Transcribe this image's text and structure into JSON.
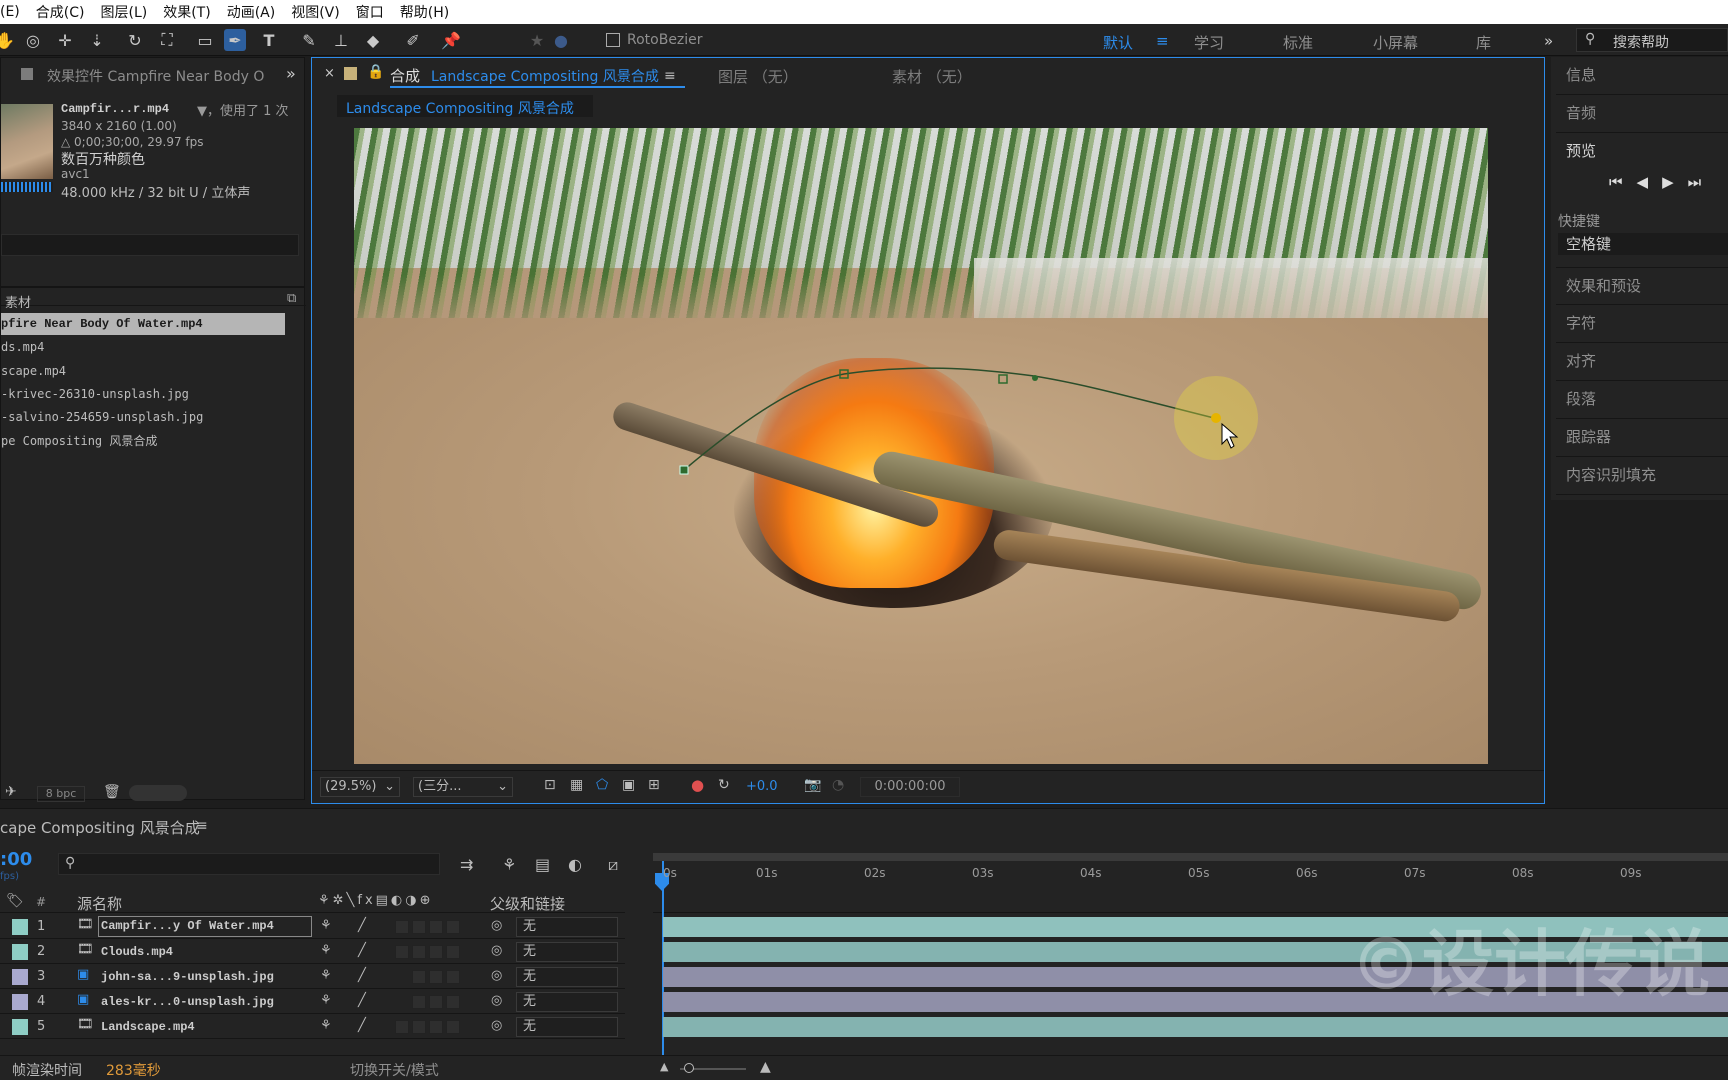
{
  "menu": [
    "(E)",
    "合成(C)",
    "图层(L)",
    "效果(T)",
    "动画(A)",
    "视图(V)",
    "窗口",
    "帮助(H)"
  ],
  "toolbar": {
    "rotobezier": "RotoBezier",
    "workspaces": [
      "默认",
      "学习",
      "标准",
      "小屏幕",
      "库"
    ],
    "search_placeholder": "搜索帮助",
    "more": "»"
  },
  "effects_panel": {
    "title": "效果控件 Campfire Near Body O"
  },
  "footage_info": {
    "name": "Campfir...r.mp4",
    "used": "▼，使用了 1 次",
    "resolution": "3840 x 2160 (1.00)",
    "duration": "△ 0;00;30;00, 29.97 fps",
    "colors": "数百万种颜色",
    "codec": "avc1",
    "audio": "48.000 kHz / 32 bit U / 立体声"
  },
  "project": {
    "header": "素材",
    "items": [
      "pfire Near Body Of Water.mp4",
      "ds.mp4",
      "scape.mp4",
      "-krivec-26310-unsplash.jpg",
      "-salvino-254659-unsplash.jpg",
      "pe Compositing 风景合成"
    ],
    "bpc": "8 bpc"
  },
  "viewer": {
    "tab_comp_prefix": "合成",
    "tab_comp_name": "Landscape Compositing 风景合成",
    "tab_layer": "图层 （无）",
    "tab_footage": "素材 （无）",
    "sub_tab": "Landscape Compositing 风景合成",
    "zoom": "(29.5%)",
    "resolution": "(三分...",
    "exposure": "+0.0",
    "timecode": "0:00:00:00"
  },
  "right_panel": {
    "info": "信息",
    "audio": "音频",
    "preview": "预览",
    "shortcut_label": "快捷键",
    "shortcut_value": "空格键",
    "items": [
      "效果和预设",
      "字符",
      "对齐",
      "段落",
      "跟踪器",
      "内容识别填充"
    ]
  },
  "timeline": {
    "comp_name": "cape Compositing 风景合成",
    "time": ":00",
    "fps": "fps)",
    "col_source": "源名称",
    "col_num": "#",
    "col_parent": "父级和链接",
    "ticks": [
      "0s",
      "01s",
      "02s",
      "03s",
      "04s",
      "05s",
      "06s",
      "07s",
      "08s",
      "09s"
    ],
    "layers": [
      {
        "num": "1",
        "name": "Campfir...y Of Water.mp4",
        "parent": "无",
        "color": "#8ecdc4"
      },
      {
        "num": "2",
        "name": "Clouds.mp4",
        "parent": "无",
        "color": "#8ecdc4"
      },
      {
        "num": "3",
        "name": "john-sa...9-unsplash.jpg",
        "parent": "无",
        "color": "#a9a9cf"
      },
      {
        "num": "4",
        "name": "ales-kr...0-unsplash.jpg",
        "parent": "无",
        "color": "#a9a9cf"
      },
      {
        "num": "5",
        "name": "Landscape.mp4",
        "parent": "无",
        "color": "#8ecdc4"
      }
    ],
    "render_label": "帧渲染时间",
    "render_value": "283毫秒",
    "toggle_label": "切换开关/模式"
  },
  "watermark": "©设计传说",
  "colors": {
    "accent": "#2d8ceb",
    "bar_teal": "#8fc1bd",
    "bar_lavender": "#8f8fa8"
  }
}
